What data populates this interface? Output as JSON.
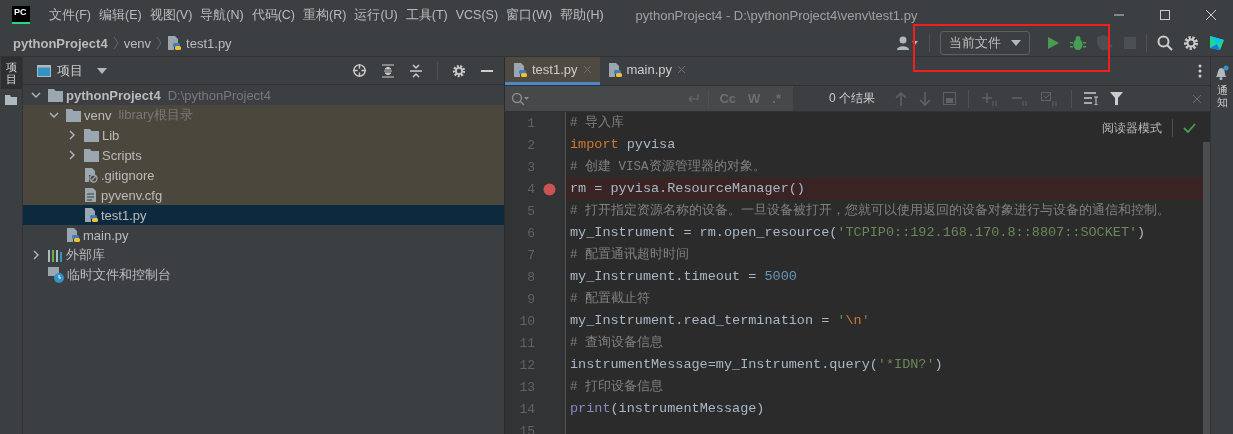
{
  "window": {
    "logo": "PC",
    "title": "pythonProject4 - D:\\pythonProject4\\venv\\test1.py"
  },
  "menu": [
    "文件(F)",
    "编辑(E)",
    "视图(V)",
    "导航(N)",
    "代码(C)",
    "重构(R)",
    "运行(U)",
    "工具(T)",
    "VCS(S)",
    "窗口(W)",
    "帮助(H)"
  ],
  "breadcrumb": [
    {
      "text": "pythonProject4",
      "kind": "project"
    },
    {
      "text": "venv",
      "kind": "folder"
    },
    {
      "text": "test1.py",
      "kind": "python"
    }
  ],
  "toolbar": {
    "run_config": "当前文件",
    "run_buttons": [
      {
        "kind": "run",
        "disabled": false
      },
      {
        "kind": "debug",
        "disabled": false
      },
      {
        "kind": "coverage",
        "disabled": true
      },
      {
        "kind": "stop",
        "disabled": true
      }
    ],
    "annotation": {
      "kind": "frame"
    }
  },
  "left_strip": {
    "label": "项目",
    "selected": true
  },
  "project_panel": {
    "title": "项目",
    "tree": [
      {
        "name": "pythonProject4",
        "kind": "project",
        "hint": "D:\\pythonProject4",
        "expanded": true,
        "selected": false,
        "tinted": false,
        "children": [
          {
            "name": "venv",
            "kind": "folder",
            "hint": "library根目录",
            "expanded": true,
            "selected": false,
            "tinted": true,
            "children": [
              {
                "name": "Lib",
                "kind": "folder",
                "expanded": false,
                "selected": false,
                "tinted": true
              },
              {
                "name": "Scripts",
                "kind": "folder",
                "expanded": false,
                "selected": false,
                "tinted": true
              },
              {
                "name": ".gitignore",
                "kind": "ignore",
                "selected": false,
                "tinted": true
              },
              {
                "name": "pyvenv.cfg",
                "kind": "text",
                "selected": false,
                "tinted": true
              },
              {
                "name": "test1.py",
                "kind": "python",
                "selected": true
              }
            ]
          },
          {
            "name": "main.py",
            "kind": "python",
            "selected": false,
            "tinted": false
          }
        ]
      },
      {
        "name": "外部库",
        "kind": "library",
        "expanded": false,
        "selected": false,
        "tinted": false
      },
      {
        "name": "临时文件和控制台",
        "kind": "scratch",
        "selected": false,
        "tinted": false
      }
    ]
  },
  "editor": {
    "tabs": [
      {
        "label": "test1.py",
        "selected": true
      },
      {
        "label": "main.py",
        "selected": false
      }
    ],
    "search": {
      "options": [
        "Cc",
        "W",
        ".*"
      ],
      "result": "0 个结果"
    },
    "reader_mode": "阅读器模式",
    "lines": [
      {
        "number": "1",
        "breakpoint": false,
        "tokens": [
          {
            "kind": "comment",
            "text": "# 导入库"
          }
        ]
      },
      {
        "number": "2",
        "breakpoint": false,
        "tokens": [
          {
            "kind": "keyword",
            "text": "import"
          },
          {
            "kind": "plain",
            "text": " pyvisa"
          }
        ]
      },
      {
        "number": "3",
        "breakpoint": false,
        "tokens": [
          {
            "kind": "comment",
            "text": "# 创建 VISA资源管理器的对象。"
          }
        ]
      },
      {
        "number": "4",
        "breakpoint": true,
        "tokens": [
          {
            "kind": "plain",
            "text": "rm = pyvisa.ResourceManager()"
          }
        ]
      },
      {
        "number": "5",
        "breakpoint": false,
        "tokens": [
          {
            "kind": "comment",
            "text": "# 打开指定资源名称的设备。一旦设备被打开，您就可以使用返回的设备对象进行与设备的通信和控制。"
          }
        ]
      },
      {
        "number": "6",
        "breakpoint": false,
        "tokens": [
          {
            "kind": "plain",
            "text": "my_Instrument = rm.open_resource("
          },
          {
            "kind": "string",
            "text": "'TCPIP0::192.168.170.8::8807::SOCKET'"
          },
          {
            "kind": "plain",
            "text": ")"
          }
        ]
      },
      {
        "number": "7",
        "breakpoint": false,
        "tokens": [
          {
            "kind": "comment",
            "text": "# 配置通讯超时时间"
          }
        ]
      },
      {
        "number": "8",
        "breakpoint": false,
        "tokens": [
          {
            "kind": "plain",
            "text": "my_Instrument.timeout = "
          },
          {
            "kind": "number",
            "text": "5000"
          }
        ]
      },
      {
        "number": "9",
        "breakpoint": false,
        "tokens": [
          {
            "kind": "comment",
            "text": "# 配置截止符"
          }
        ]
      },
      {
        "number": "10",
        "breakpoint": false,
        "tokens": [
          {
            "kind": "plain",
            "text": "my_Instrument.read_termination = "
          },
          {
            "kind": "string",
            "text": "'"
          },
          {
            "kind": "keyword",
            "text": "\\n"
          },
          {
            "kind": "string",
            "text": "'"
          }
        ]
      },
      {
        "number": "11",
        "breakpoint": false,
        "tokens": [
          {
            "kind": "comment",
            "text": "# 查询设备信息"
          }
        ]
      },
      {
        "number": "12",
        "breakpoint": false,
        "tokens": [
          {
            "kind": "plain",
            "text": "instrumentMessage=my_Instrument.query("
          },
          {
            "kind": "string",
            "text": "'*IDN?'"
          },
          {
            "kind": "plain",
            "text": ")"
          }
        ]
      },
      {
        "number": "13",
        "breakpoint": false,
        "tokens": [
          {
            "kind": "comment",
            "text": "# 打印设备信息"
          }
        ]
      },
      {
        "number": "14",
        "breakpoint": false,
        "tokens": [
          {
            "kind": "builtin",
            "text": "print"
          },
          {
            "kind": "plain",
            "text": "(instrumentMessage)"
          }
        ]
      },
      {
        "number": "15"
      }
    ]
  },
  "right_strip": {
    "label": "通知"
  }
}
